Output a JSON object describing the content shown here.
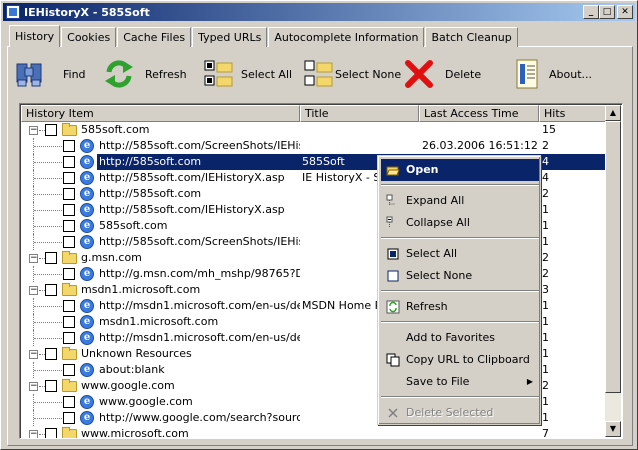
{
  "window": {
    "title": "IEHistoryX  - 585Soft",
    "min": "_",
    "max": "□",
    "close": "✕"
  },
  "tabs": [
    "History",
    "Cookies",
    "Cache Files",
    "Typed URLs",
    "Autocomplete Information",
    "Batch Cleanup"
  ],
  "toolbar": {
    "find": "Find",
    "refresh": "Refresh",
    "select_all": "Select All",
    "select_none": "Select None",
    "delete": "Delete",
    "about": "About..."
  },
  "columns": {
    "item": "History Item",
    "title": "Title",
    "access": "Last Access Time",
    "hits": "Hits"
  },
  "rows": [
    {
      "name": "585soft.com",
      "title": "",
      "access": "",
      "hits": "15"
    },
    {
      "name": "http://585soft.com/ScreenShots/IEHist...",
      "title": "",
      "access": "26.03.2006 16:51:12",
      "hits": "2"
    },
    {
      "name": "http://585soft.com",
      "title": "585Soft",
      "access": "",
      "hits": "4"
    },
    {
      "name": "http://585soft.com/IEHistoryX.asp",
      "title": "IE HistoryX - Sel",
      "access": "",
      "hits": "4"
    },
    {
      "name": "http://585soft.com",
      "title": "",
      "access": "",
      "hits": "2"
    },
    {
      "name": "http://585soft.com/IEHistoryX.asp",
      "title": "",
      "access": "",
      "hits": "1"
    },
    {
      "name": "585soft.com",
      "title": "",
      "access": "",
      "hits": "1"
    },
    {
      "name": "http://585soft.com/ScreenShots/IEHist...",
      "title": "",
      "access": "",
      "hits": "1"
    },
    {
      "name": "g.msn.com",
      "title": "",
      "access": "",
      "hits": "2"
    },
    {
      "name": "http://g.msn.com/mh_mshp/98765?D4...",
      "title": "",
      "access": "",
      "hits": "2"
    },
    {
      "name": "msdn1.microsoft.com",
      "title": "",
      "access": "",
      "hits": "3"
    },
    {
      "name": "http://msdn1.microsoft.com/en-us/def...",
      "title": "MSDN Home Pag",
      "access": "",
      "hits": "1"
    },
    {
      "name": "msdn1.microsoft.com",
      "title": "",
      "access": "",
      "hits": "1"
    },
    {
      "name": "http://msdn1.microsoft.com/en-us/def...",
      "title": "",
      "access": "",
      "hits": "1"
    },
    {
      "name": "Unknown Resources",
      "title": "",
      "access": "",
      "hits": "1"
    },
    {
      "name": "about:blank",
      "title": "",
      "access": "",
      "hits": "1"
    },
    {
      "name": "www.google.com",
      "title": "",
      "access": "",
      "hits": "2"
    },
    {
      "name": "www.google.com",
      "title": "",
      "access": "",
      "hits": "1"
    },
    {
      "name": "http://www.google.com/search?source...",
      "title": "",
      "access": "",
      "hits": "1"
    },
    {
      "name": "www.microsoft.com",
      "title": "",
      "access": "",
      "hits": "7"
    }
  ],
  "context_menu": {
    "open": "Open",
    "expand_all": "Expand All",
    "collapse_all": "Collapse All",
    "select_all": "Select All",
    "select_none": "Select None",
    "refresh": "Refresh",
    "add_favorites": "Add to Favorites",
    "copy_url": "Copy URL to Clipboard",
    "save_file": "Save to File",
    "delete_selected": "Delete Selected"
  },
  "colors": {
    "selection": "#0a246a",
    "title_start": "#0a246a",
    "title_end": "#a6caf0"
  }
}
